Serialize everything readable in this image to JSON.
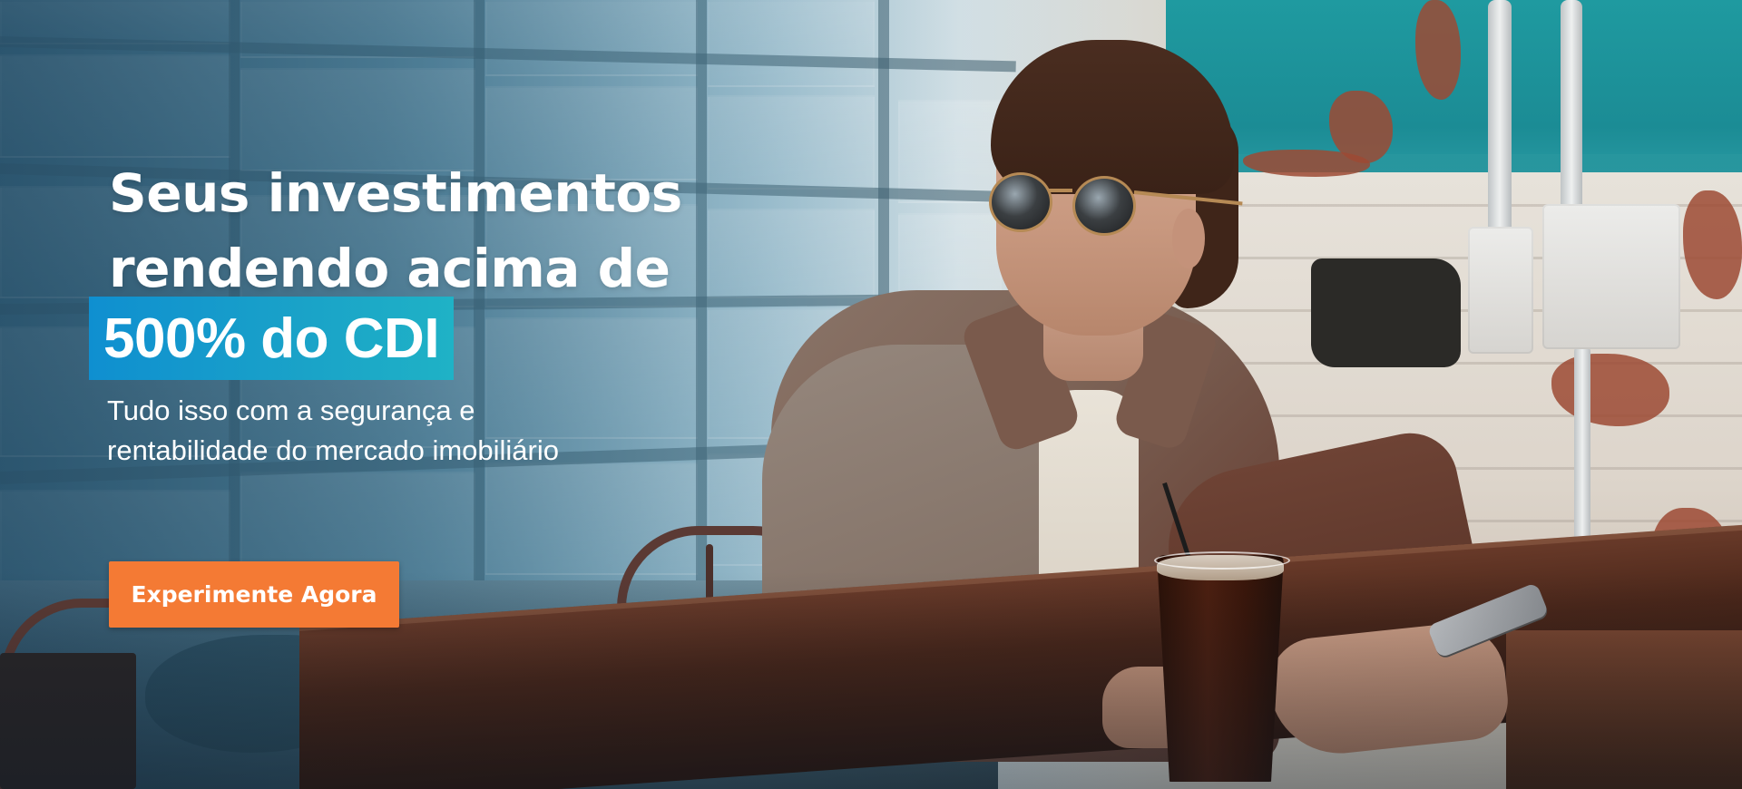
{
  "hero": {
    "headline": {
      "line1": "Seus investimentos",
      "line2": "rendendo acima de",
      "highlight": "500% do CDI"
    },
    "subtitle": {
      "line1": "Tudo isso com a segurança e",
      "line2": "rentabilidade do mercado imobiliário"
    },
    "cta_label": "Experimente Agora"
  },
  "colors": {
    "cta": "#f47a34",
    "highlight_start": "#0f8fd0",
    "highlight_end": "#1fb2c6",
    "text": "#ffffff"
  }
}
